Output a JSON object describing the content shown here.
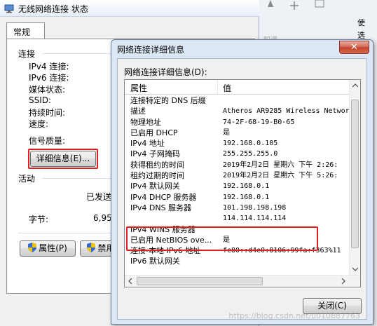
{
  "status_window": {
    "title": "无线网络连接 状态",
    "tab": "常规",
    "connection": {
      "heading": "连接",
      "labels": [
        "IPv4 连接:",
        "IPv6 连接:",
        "媒体状态:",
        "SSID:",
        "持续时间:",
        "速度:"
      ],
      "signal_label": "信号质量:",
      "details_button": "详细信息(E)..."
    },
    "activity": {
      "heading": "活动",
      "sent_label": "已发送",
      "bytes_label": "字节:",
      "bytes_sent": "6,95"
    },
    "properties_button": "属性(P)",
    "disable_button": "禁用"
  },
  "background_right": {
    "item1": "使",
    "item2": "选",
    "item3": "知道"
  },
  "details_dialog": {
    "title": "网络连接详细信息",
    "list_caption": "网络连接详细信息(D):",
    "columns": {
      "property": "属性",
      "value": "值"
    },
    "rows": [
      {
        "p": "连接特定的 DNS 后缀",
        "v": ""
      },
      {
        "p": "描述",
        "v": "Atheros AR9285 Wireless Networ"
      },
      {
        "p": "物理地址",
        "v": "74-2F-68-19-B0-65"
      },
      {
        "p": "已启用 DHCP",
        "v": "是"
      },
      {
        "p": "IPv4 地址",
        "v": "192.168.0.105"
      },
      {
        "p": "IPv4 子网掩码",
        "v": "255.255.255.0"
      },
      {
        "p": "获得租约的时间",
        "v": "2019年2月2日 星期六 下午 2:26:"
      },
      {
        "p": "租约过期的时间",
        "v": "2019年2月2日 星期六 下午 5:26:"
      },
      {
        "p": "IPv4 默认网关",
        "v": "192.168.0.1"
      },
      {
        "p": "IPv4 DHCP 服务器",
        "v": "192.168.0.1"
      },
      {
        "p": "IPv4 DNS 服务器",
        "v": "101.198.198.198"
      },
      {
        "p": "",
        "v": "114.114.114.114"
      },
      {
        "p": "IPv4 WINS 服务器",
        "v": ""
      },
      {
        "p": "已启用 NetBIOS ove...",
        "v": "是"
      },
      {
        "p": "连接-本地 IPv6 地址",
        "v": "fe80::d4e0:8106:99fa:f363%11"
      },
      {
        "p": "IPv6 默认网关",
        "v": ""
      }
    ],
    "close_button": "关闭(C)"
  },
  "watermark": "https://blog.csdn.net/u010887763",
  "colors": {
    "highlight": "#e02020",
    "title_bg": "#dbe7f5",
    "close_red": "#c5432c"
  }
}
